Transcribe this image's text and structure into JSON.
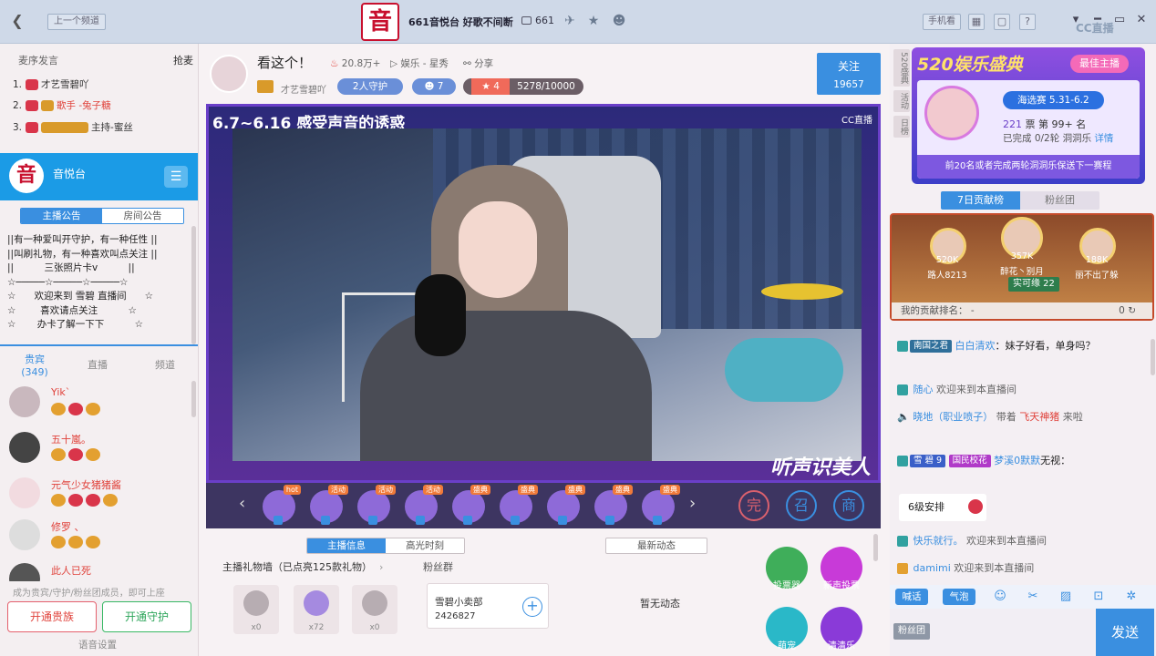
{
  "topbar": {
    "prev_channel": "上一个频道",
    "channel_title": "661音悦台 好歌不间断",
    "viewers": "661",
    "logo_char": "音",
    "mobile_btn": "手机看",
    "cc_brand": "CC直播"
  },
  "rank": {
    "header": "麦序发言",
    "grab": "抢麦",
    "items": [
      {
        "num": "1.",
        "name": "才艺雪碧吖"
      },
      {
        "num": "2.",
        "name": "歌手 -兔子糖"
      },
      {
        "num": "3.",
        "name": "主持-蜜丝"
      }
    ]
  },
  "channel": {
    "logo_char": "音",
    "name": "音悦台",
    "tabs": [
      "主播公告",
      "房间公告"
    ],
    "notice": [
      "||有一种爱叫开守护，有一种任性 ||",
      "||叫刷礼物，有一种喜欢叫点关注 ||",
      "||          三张照片卡v          ||",
      "☆─────☆─────☆─────☆",
      "☆      欢迎来到 雪碧 直播间      ☆",
      "☆        喜欢请点关注          ☆",
      "☆       办卡了解一下下          ☆"
    ]
  },
  "audience": {
    "tabs": [
      {
        "label": "贵宾",
        "count": "(349)"
      },
      {
        "label": "直播"
      },
      {
        "label": "频道"
      }
    ],
    "items": [
      "Yik`",
      "五十嵐。",
      "元气少女猪猪酱",
      "修罗 、",
      "此人已死"
    ],
    "hint": "成为贵宾/守护/粉丝团成员，即可上座",
    "open_vip": "开通贵族",
    "open_guard": "开通守护",
    "voice_settings": "语音设置"
  },
  "anchor": {
    "title": "看这个！",
    "heat": "20.8万+",
    "category": "娱乐 - 星秀",
    "share": "分享",
    "name": "才艺雪碧吖",
    "guards": "2人守护",
    "fans": "7",
    "level": "4",
    "exp": "5278",
    "exp_total": "/10000",
    "follow_label": "关注",
    "follow_count": "19657"
  },
  "stage": {
    "caption": "6.7~6.16 感受声音的诱惑",
    "cc": "CC直播",
    "sign": "听声识美人"
  },
  "gifts": [
    "hot",
    "活动",
    "活动",
    "活动",
    "盛典",
    "盛典",
    "盛典",
    "盛典",
    "盛典"
  ],
  "tools": [
    "完",
    "召",
    "商"
  ],
  "info": {
    "tabs": [
      "主播信息",
      "高光时刻"
    ],
    "latest": "最新动态",
    "gift_wall": "主播礼物墙（已点亮125款礼物）",
    "fans_group": "粉丝群",
    "wall_counts": [
      "x0",
      "x72",
      "x0"
    ],
    "fan_card_name": "雪碧小卖部",
    "fan_card_id": "2426827",
    "no_news": "暂无动态",
    "acts": [
      "投票器",
      "新声投票",
      "萌宠",
      "清清乐"
    ]
  },
  "promo": {
    "side": [
      "520盛典",
      "活动",
      "日榜"
    ],
    "title": "520娱乐盛典",
    "best": "最佳主播",
    "date": "海选赛 5.31-6.2",
    "votes": "221",
    "votes_unit": "票",
    "rank": "第 99+ 名",
    "task": "已完成 0/2轮 洞洞乐",
    "detail": "详情",
    "footer": "前20名或者完成两轮洞洞乐保送下一赛程"
  },
  "contrib": {
    "tabs": [
      "7日贡献榜",
      "粉丝团"
    ],
    "top": [
      {
        "name": "路人8213",
        "score": "520K"
      },
      {
        "name": "醉花丶别月",
        "score": "357K"
      },
      {
        "name": "丽不出了躲",
        "score": "188K"
      }
    ],
    "hot": "实可缘 22",
    "my_rank": "我的贡献排名：  -",
    "my_score": "0"
  },
  "chat": [
    {
      "badge": "南国之君",
      "name": "白白清欢",
      "text": "：妹子好看，单身吗？"
    },
    {
      "name": "随心",
      "text": "欢迎来到本直播间"
    },
    {
      "name": "晓地（职业喷子）",
      "text": "带着",
      "gift": "飞天神猪",
      "tail": "来啦"
    },
    {
      "badge": "雪 碧 9",
      "tag": "国民校花",
      "name": "梦溪0默默",
      "text": "无视："
    },
    {
      "name": "快乐就行。",
      "text": "欢迎来到本直播间"
    },
    {
      "name": "damimi",
      "text": "欢迎来到本直播间"
    }
  ],
  "bubble": "6级安排",
  "input": {
    "btn_talk": "喊话",
    "btn_bubble": "气泡",
    "fan_tag": "粉丝团",
    "send": "发送"
  }
}
